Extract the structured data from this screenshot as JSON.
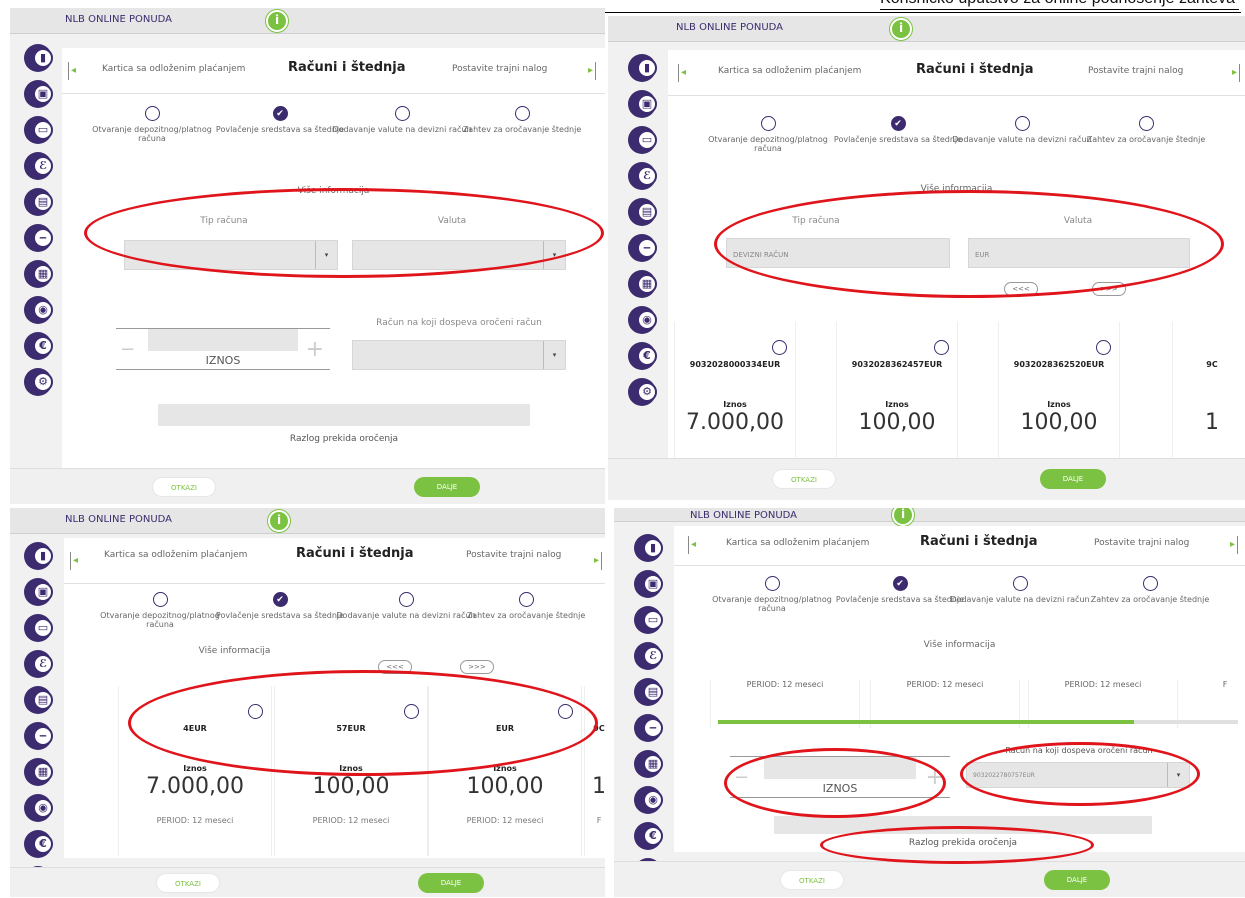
{
  "doc_header": "Korisničko uputstvo za online podnošenje zahteva",
  "app": {
    "brand": "NLB ONLINE PONUDA",
    "info_glyph": "i",
    "tab_prev": "Kartica sa odloženim plaćanjem",
    "tab_active": "Računi i štednja",
    "tab_next": "Postavite trajni nalog",
    "arrow_left": "◂",
    "arrow_right": "▸",
    "options": [
      "Otvaranje depozitnog/platnog računa",
      "Povlačenje sredstava sa štednje",
      "Dodavanje valute na devizni račun",
      "Zahtev za oročavanje štednje"
    ],
    "checkmark": "✔",
    "more_info": "Više informacija",
    "account_type_label": "Tip računa",
    "currency_label": "Valuta",
    "account_type_value": "DEVIZNI RAČUN",
    "currency_value": "EUR",
    "dropdown_glyph": "▾",
    "target_account_label": "Račun na koji dospeva oročeni račun",
    "target_account_value": "9032022780757EUR",
    "amount_label": "IZNOS",
    "minus": "−",
    "plus": "+",
    "reason_label": "Razlog prekida oročenja",
    "cancel": "OTKAZI",
    "next": "DALJE",
    "pager_prev": "<<<",
    "pager_next": ">>>",
    "amount_caption": "Iznos",
    "period": "PERIOD: 12 meseci",
    "period_cut": "F",
    "accounts": [
      {
        "number": "9032028000334EUR",
        "amount": "7.000,00"
      },
      {
        "number": "9032028362457EUR",
        "amount": "100,00"
      },
      {
        "number": "9032028362520EUR",
        "amount": "100,00"
      }
    ],
    "account_cut_number": "9C",
    "account_cut_amount": "1",
    "masked_accounts": [
      "90",
      "4EUR",
      "90",
      "57EUR",
      "90",
      "EUR"
    ]
  },
  "sidebar_icons": [
    "chart-icon",
    "briefcase-icon",
    "card-icon",
    "loan-icon",
    "exchange-icon",
    "minus-icon",
    "stack-icon",
    "location-icon",
    "euro-icon",
    "gear-icon"
  ],
  "sidebar_glyphs": [
    "▮",
    "▣",
    "▭",
    "ℰ",
    "▤",
    "‒",
    "▦",
    "◉",
    "€",
    "⚙"
  ],
  "colors": {
    "accent": "#7cc242",
    "brand": "#3c2b6e",
    "highlight": "#e0141b"
  }
}
